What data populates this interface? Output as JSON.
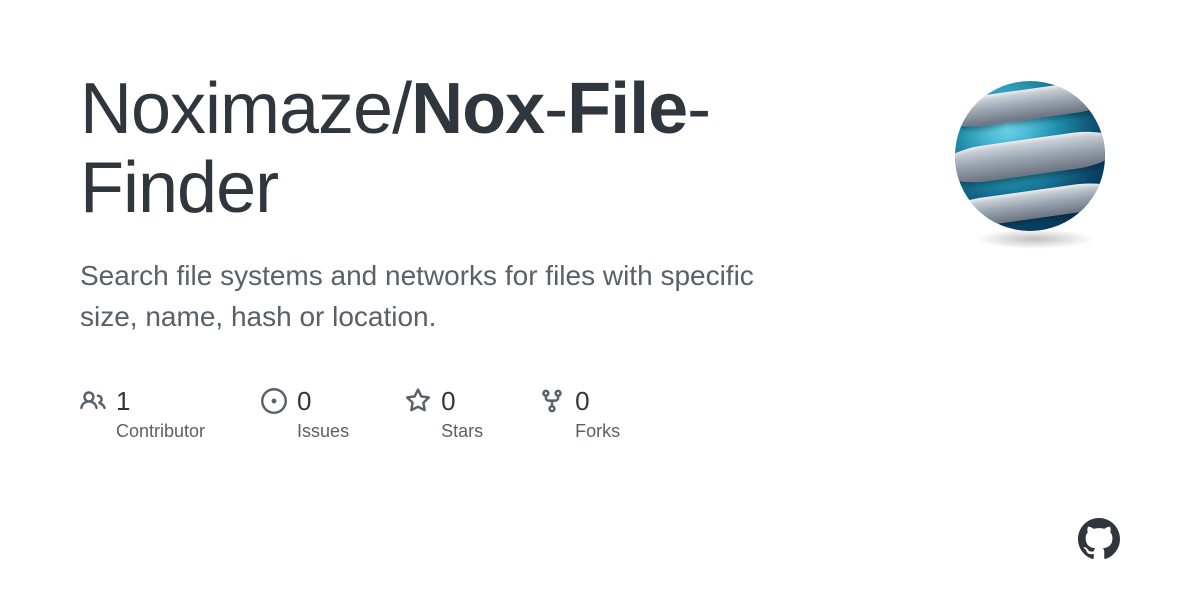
{
  "repo": {
    "owner": "Noximaze",
    "separator": "/",
    "name_part1": "Nox",
    "name_dash1": "-",
    "name_part2": "File",
    "name_dash2": "-",
    "name_part3": "Finder"
  },
  "description": "Search file systems and networks for files with specific size, name, hash or location.",
  "stats": {
    "contributors": {
      "count": "1",
      "label": "Contributor"
    },
    "issues": {
      "count": "0",
      "label": "Issues"
    },
    "stars": {
      "count": "0",
      "label": "Stars"
    },
    "forks": {
      "count": "0",
      "label": "Forks"
    }
  }
}
